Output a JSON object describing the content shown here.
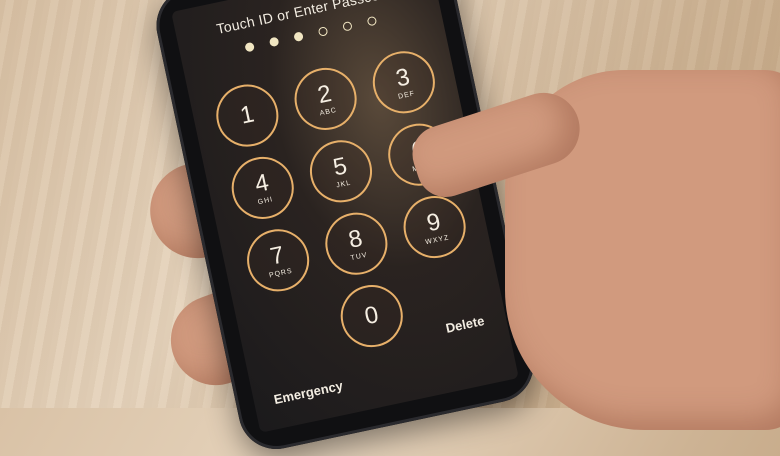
{
  "lock_screen": {
    "title": "Touch ID or Enter Passcode",
    "passcode_dots": [
      "filled",
      "filled",
      "filled",
      "empty",
      "empty",
      "empty"
    ],
    "keys": [
      {
        "num": "1",
        "letters": ""
      },
      {
        "num": "2",
        "letters": "ABC"
      },
      {
        "num": "3",
        "letters": "DEF"
      },
      {
        "num": "4",
        "letters": "GHI"
      },
      {
        "num": "5",
        "letters": "JKL"
      },
      {
        "num": "6",
        "letters": "MNO"
      },
      {
        "num": "7",
        "letters": "PQRS"
      },
      {
        "num": "8",
        "letters": "TUV"
      },
      {
        "num": "9",
        "letters": "WXYZ"
      },
      {
        "num": "0",
        "letters": ""
      }
    ],
    "emergency_label": "Emergency",
    "delete_label": "Delete"
  },
  "colors": {
    "key_ring": "#e7b06a",
    "dot": "#f1e6c2"
  }
}
